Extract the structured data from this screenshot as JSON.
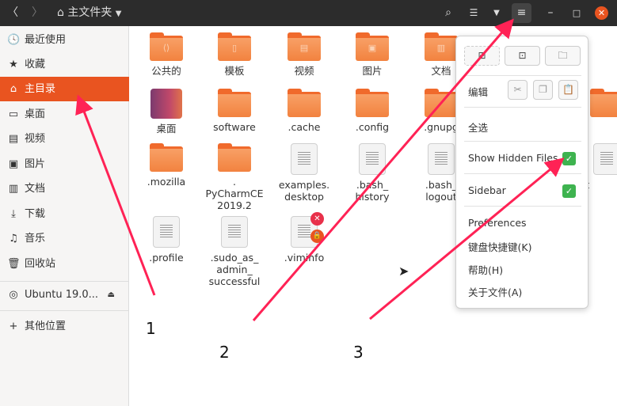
{
  "header": {
    "back_icon": "chevron-left",
    "forward_icon": "chevron-right",
    "path_label": "主文件夹",
    "search_icon": "search",
    "view_icon": "list-view",
    "menu_icon": "hamburger-menu"
  },
  "colors": {
    "accent": "#e95420",
    "header_bg": "#2c2c2c",
    "check": "#3eb34f",
    "annotation": "#ff2255"
  },
  "sidebar": {
    "items": [
      {
        "label": "最近使用",
        "icon": "🕓"
      },
      {
        "label": "收藏",
        "icon": "★"
      },
      {
        "label": "主目录",
        "icon": "⌂",
        "active": true
      },
      {
        "label": "桌面",
        "icon": "▭"
      },
      {
        "label": "视频",
        "icon": "▤"
      },
      {
        "label": "图片",
        "icon": "▣"
      },
      {
        "label": "文档",
        "icon": "▥"
      },
      {
        "label": "下载",
        "icon": "⤓"
      },
      {
        "label": "音乐",
        "icon": "♫"
      },
      {
        "label": "回收站",
        "icon": "🗑"
      }
    ],
    "device": {
      "label": "Ubuntu 19.0...",
      "eject": "⏏"
    },
    "other": {
      "label": "其他位置",
      "icon": "+"
    }
  },
  "files": [
    {
      "name": "公共的",
      "type": "folder",
      "sym": "⟨⟩"
    },
    {
      "name": "模板",
      "type": "folder",
      "sym": "▯"
    },
    {
      "name": "视频",
      "type": "folder",
      "sym": "▤"
    },
    {
      "name": "图片",
      "type": "folder",
      "sym": "▣"
    },
    {
      "name": "文档",
      "type": "folder",
      "sym": "▥"
    },
    {
      "name": "桌面",
      "type": "desktop"
    },
    {
      "name": "software",
      "type": "folder"
    },
    {
      "name": ".cache",
      "type": "folder"
    },
    {
      "name": ".config",
      "type": "folder"
    },
    {
      "name": ".gnupg",
      "type": "folder"
    },
    {
      "name": "l",
      "type": "folder"
    },
    {
      "name": ".mozilla",
      "type": "folder"
    },
    {
      "name": ".\nPyCharmCE\n2019.2",
      "type": "folder"
    },
    {
      "name": "examples.\ndesktop",
      "type": "doc"
    },
    {
      "name": ".bash_\nhistory",
      "type": "doc"
    },
    {
      "name": ".bash_\nlogout",
      "type": "doc"
    },
    {
      "name": "orit",
      "type": "doc"
    },
    {
      "name": ".profile",
      "type": "doc"
    },
    {
      "name": ".sudo_as_\nadmin_\nsuccessful",
      "type": "doc"
    },
    {
      "name": ".viminfo",
      "type": "doc",
      "locked": true
    }
  ],
  "menu": {
    "edit_label": "编辑",
    "select_all": "全选",
    "show_hidden": "Show Hidden Files",
    "show_hidden_checked": true,
    "sidebar": "Sidebar",
    "sidebar_checked": true,
    "preferences": "Preferences",
    "shortcuts": "键盘快捷键(K)",
    "help": "帮助(H)",
    "about": "关于文件(A)"
  },
  "annotations": [
    "1",
    "2",
    "3"
  ]
}
